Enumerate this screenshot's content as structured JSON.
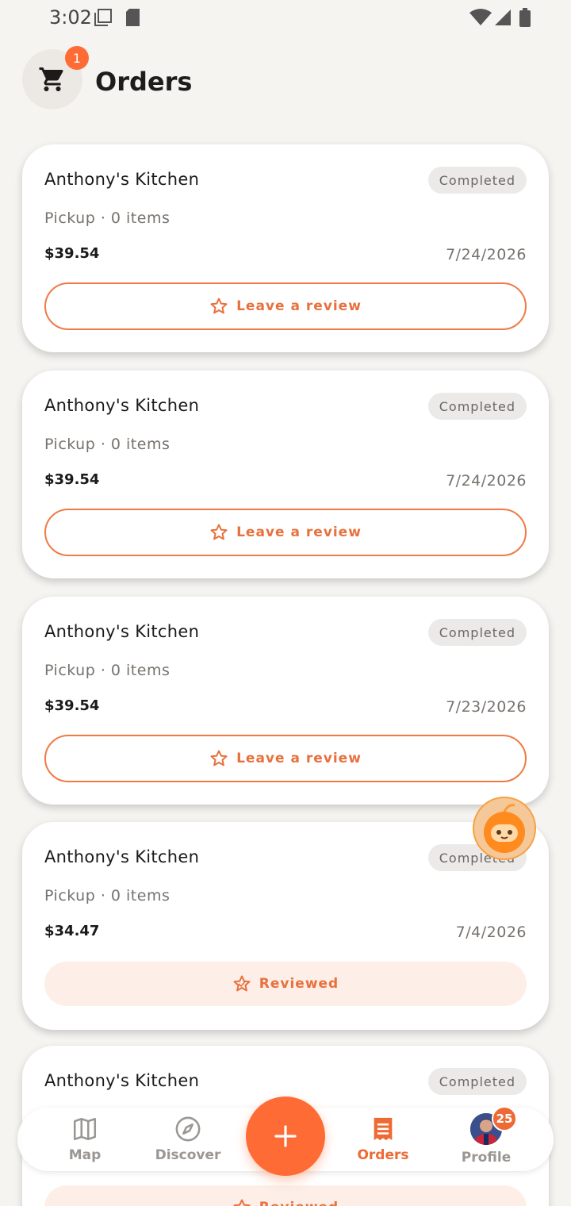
{
  "status_bar": {
    "time": "3:02"
  },
  "header": {
    "title": "Orders",
    "cart_count": "1"
  },
  "orders": [
    {
      "restaurant": "Anthony's Kitchen",
      "status": "Completed",
      "meta": "Pickup · 0 items",
      "price": "$39.54",
      "date": "7/24/2026",
      "action": "Leave a review"
    },
    {
      "restaurant": "Anthony's Kitchen",
      "status": "Completed",
      "meta": "Pickup · 0 items",
      "price": "$39.54",
      "date": "7/24/2026",
      "action": "Leave a review"
    },
    {
      "restaurant": "Anthony's Kitchen",
      "status": "Completed",
      "meta": "Pickup · 0 items",
      "price": "$39.54",
      "date": "7/23/2026",
      "action": "Leave a review"
    },
    {
      "restaurant": "Anthony's Kitchen",
      "status": "Completed",
      "meta": "Pickup · 0 items",
      "price": "$34.47",
      "date": "7/4/2026",
      "action": "Reviewed"
    },
    {
      "restaurant": "Anthony's Kitchen",
      "status": "Completed",
      "action": "Reviewed"
    }
  ],
  "nav": {
    "map": "Map",
    "discover": "Discover",
    "orders": "Orders",
    "profile": "Profile",
    "profile_badge": "25"
  },
  "colors": {
    "accent": "#ff6b35",
    "background": "#f6f4f1"
  },
  "icons": [
    "cart-icon",
    "star-icon",
    "map-icon",
    "compass-icon",
    "plus-icon",
    "receipt-icon",
    "mascot-icon"
  ]
}
